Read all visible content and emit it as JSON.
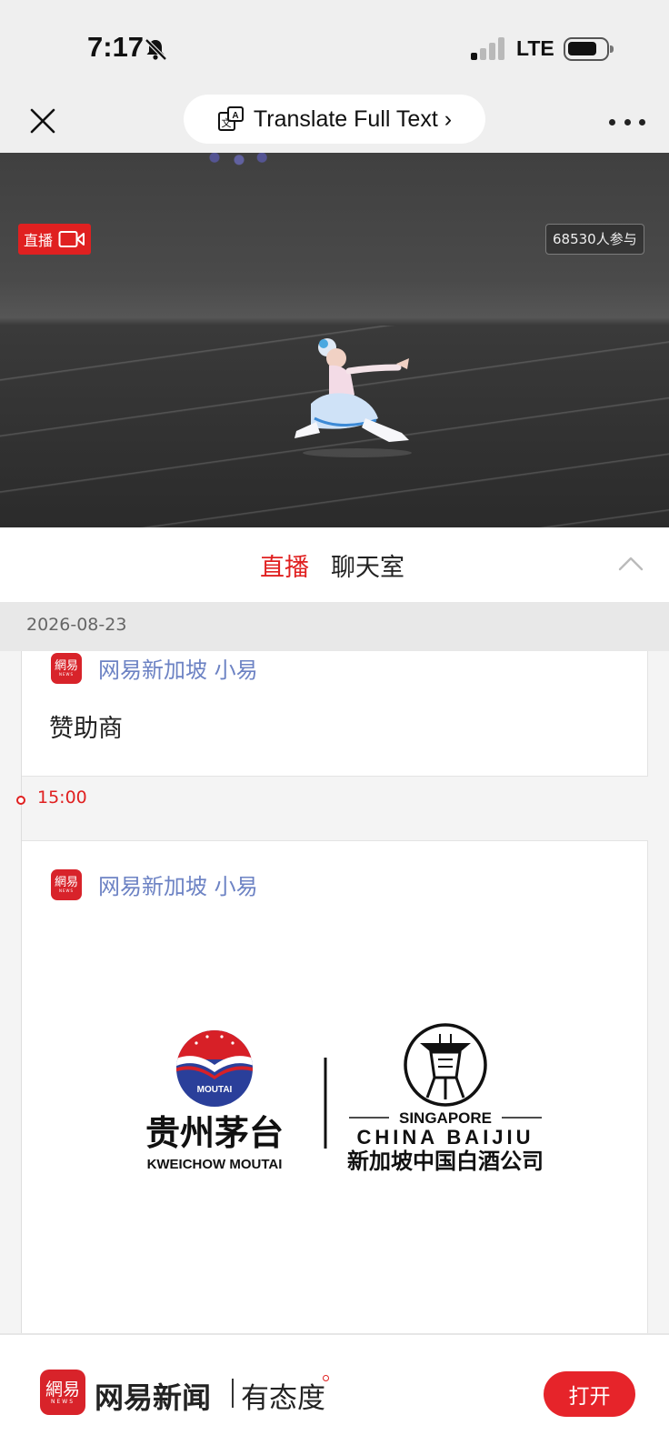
{
  "status_bar": {
    "time": "7:17",
    "network": "LTE",
    "signal_bars_active": 1,
    "signal_bars_total": 4
  },
  "topbar": {
    "translate_label": "Translate Full Text ›"
  },
  "video": {
    "live_badge": "直播",
    "viewer_count": "68530人参与"
  },
  "tabs": {
    "live": "直播",
    "chat": "聊天室",
    "active": "live"
  },
  "date": "2026-08-23",
  "feed": [
    {
      "author": "网易新加坡 小易",
      "text": "赞助商"
    },
    {
      "time": "15:00",
      "author": "网易新加坡 小易",
      "sponsor": {
        "moutai_badge": "MOUTAI",
        "moutai_cn": "贵州茅台",
        "moutai_en": "KWEICHOW MOUTAI",
        "baijiu_singapore": "SINGAPORE",
        "baijiu_en": "CHINA BAIJIU",
        "baijiu_cn": "新加坡中国白酒公司"
      }
    }
  ],
  "author_logo": {
    "cn": "網易",
    "en": "NEWS"
  },
  "bottom_bar": {
    "app_name": "网易新闻",
    "slogan": "有态度",
    "open_label": "打开"
  },
  "colors": {
    "accent_red": "#e02020",
    "author_blue": "#6d83c4"
  }
}
